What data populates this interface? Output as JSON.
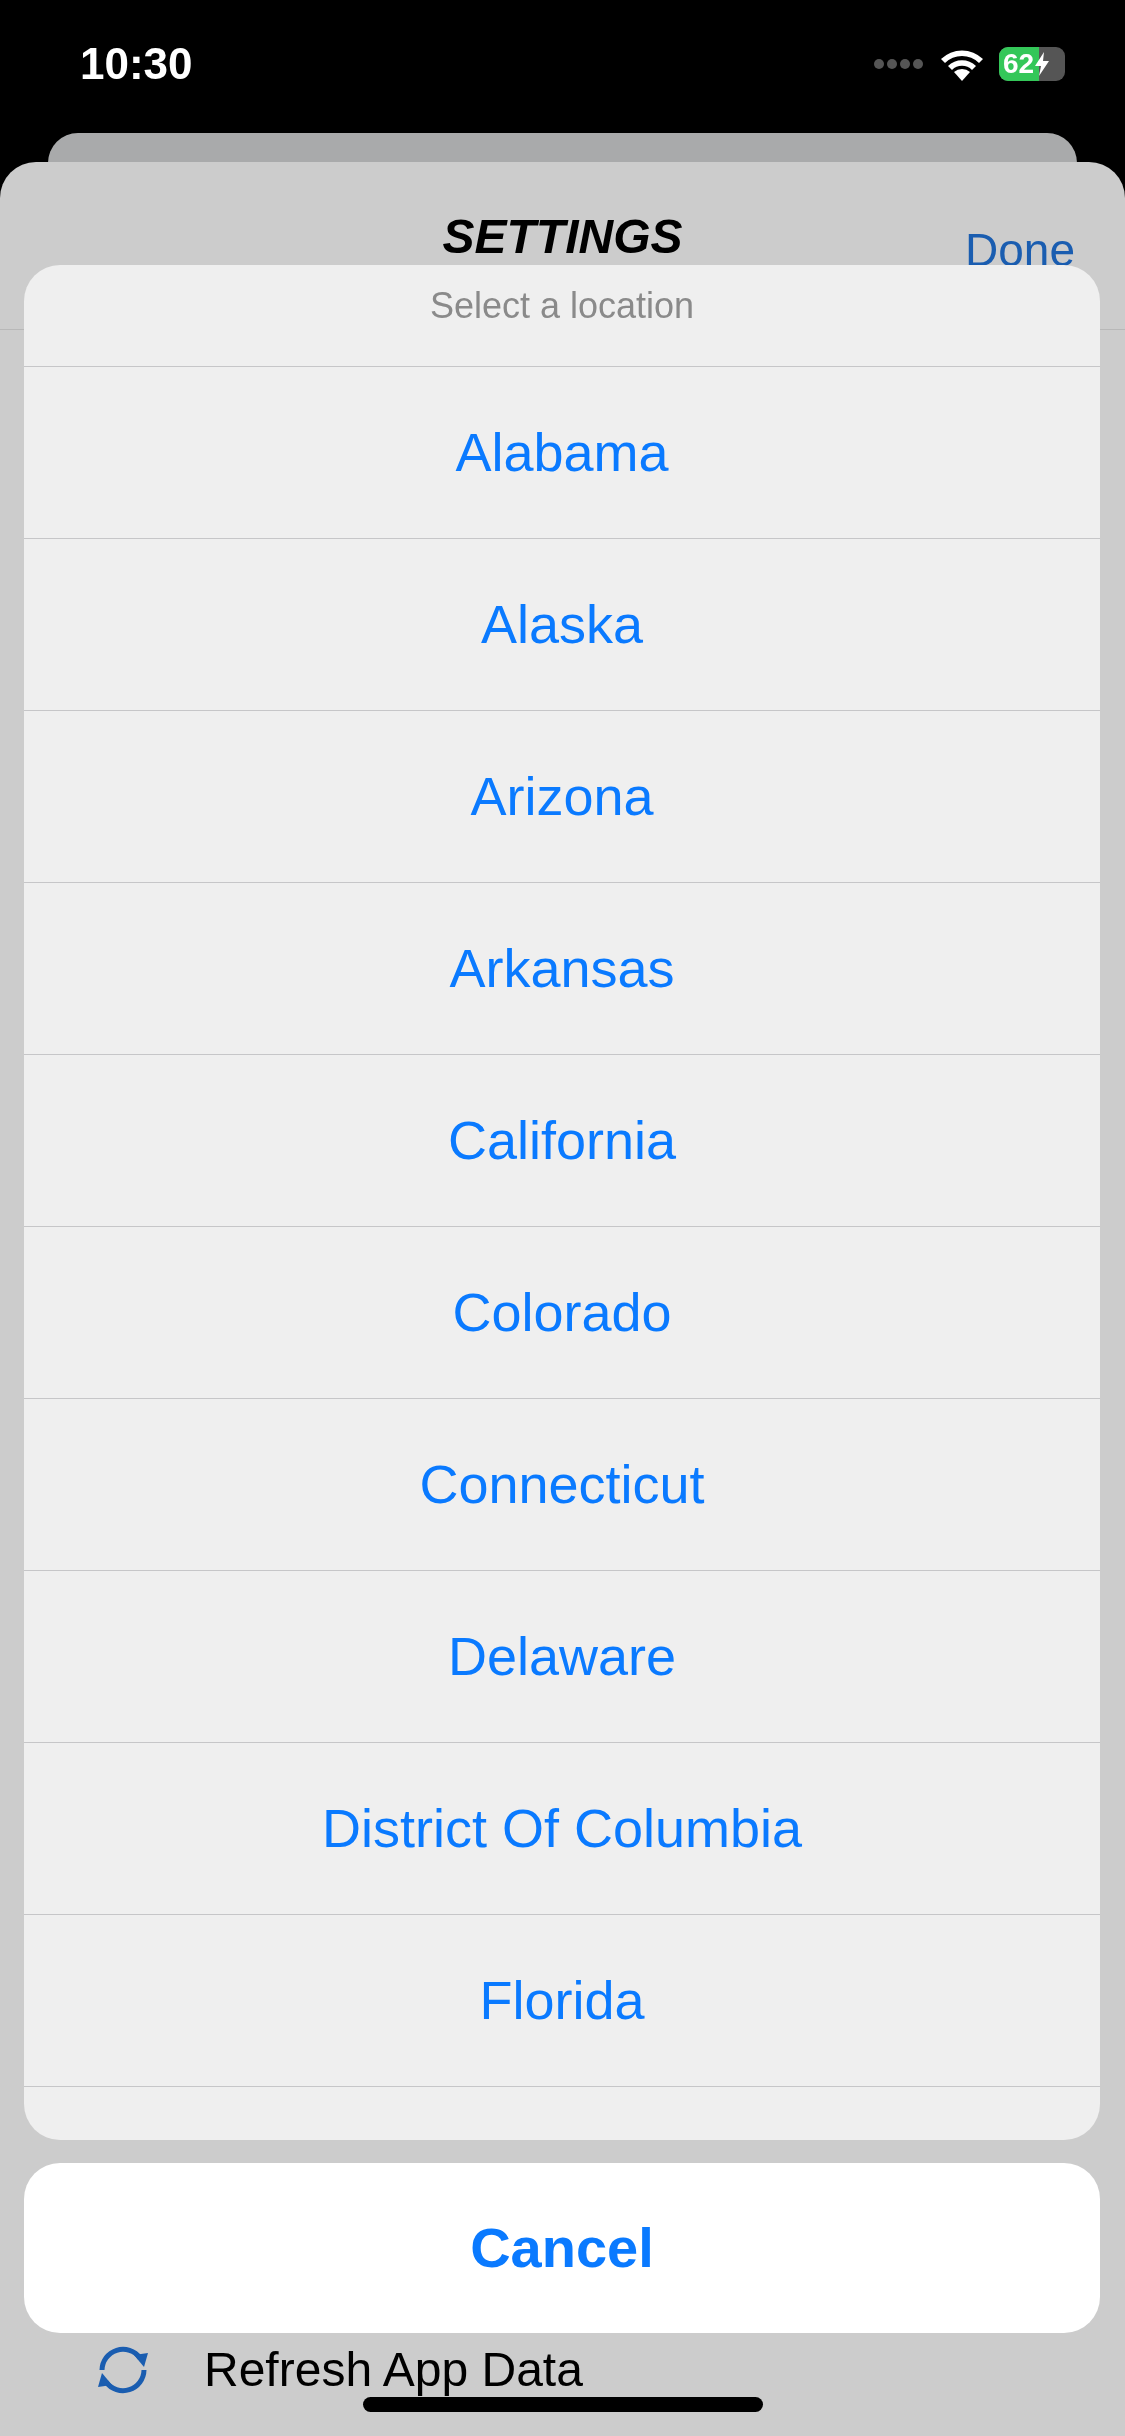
{
  "status_bar": {
    "time": "10:30",
    "battery": "62"
  },
  "background_sheet": {
    "title": "SETTINGS",
    "done": "Done",
    "rows": [
      {
        "label": "Refresh App Data"
      }
    ]
  },
  "action_sheet": {
    "title": "Select a location",
    "options": [
      {
        "label": "Alabama"
      },
      {
        "label": "Alaska"
      },
      {
        "label": "Arizona"
      },
      {
        "label": "Arkansas"
      },
      {
        "label": "California"
      },
      {
        "label": "Colorado"
      },
      {
        "label": "Connecticut"
      },
      {
        "label": "Delaware"
      },
      {
        "label": "District Of Columbia"
      },
      {
        "label": "Florida"
      }
    ],
    "cancel": "Cancel"
  }
}
